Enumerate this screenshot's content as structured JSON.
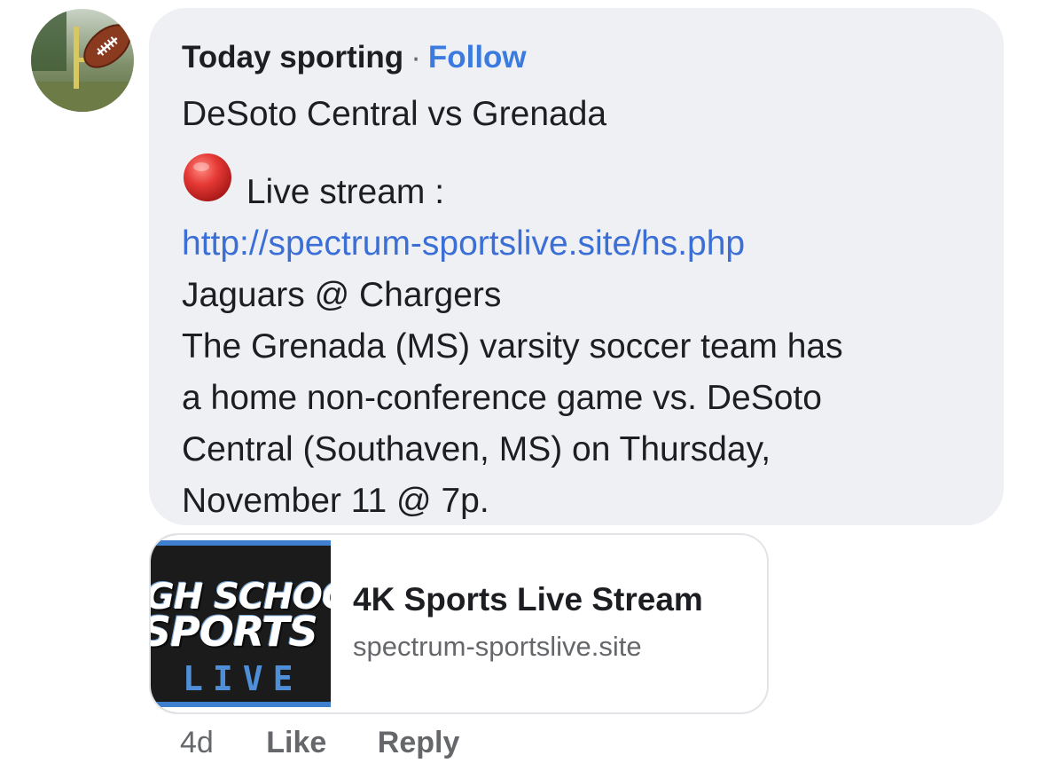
{
  "comment": {
    "author": "Today sporting",
    "separator": "·",
    "follow_label": "Follow",
    "lines": {
      "title": "DeSoto Central vs Grenada",
      "live_label": "Live stream :",
      "link": "http://spectrum-sportslive.site/hs.php",
      "matchup": "Jaguars @ Chargers",
      "desc_1": "The Grenada (MS) varsity soccer team has",
      "desc_2": "a home non-conference game vs. DeSoto",
      "desc_3": "Central (Southaven, MS) on Thursday,",
      "desc_4": "November 11 @ 7p."
    },
    "live_icon": "red-circle-icon",
    "avatar_icon": "football-icon"
  },
  "link_preview": {
    "thumb_line1": "GH SCHOO",
    "thumb_line2": "SPORTS",
    "thumb_line3": "LIVE",
    "title": "4K Sports Live Stream",
    "domain": "spectrum-sportslive.site"
  },
  "actions": {
    "age": "4d",
    "like_label": "Like",
    "reply_label": "Reply"
  },
  "colors": {
    "bubble": "#eff0f4",
    "link": "#3b6fd6",
    "follow": "#3b7be0",
    "meta": "#65676b"
  }
}
